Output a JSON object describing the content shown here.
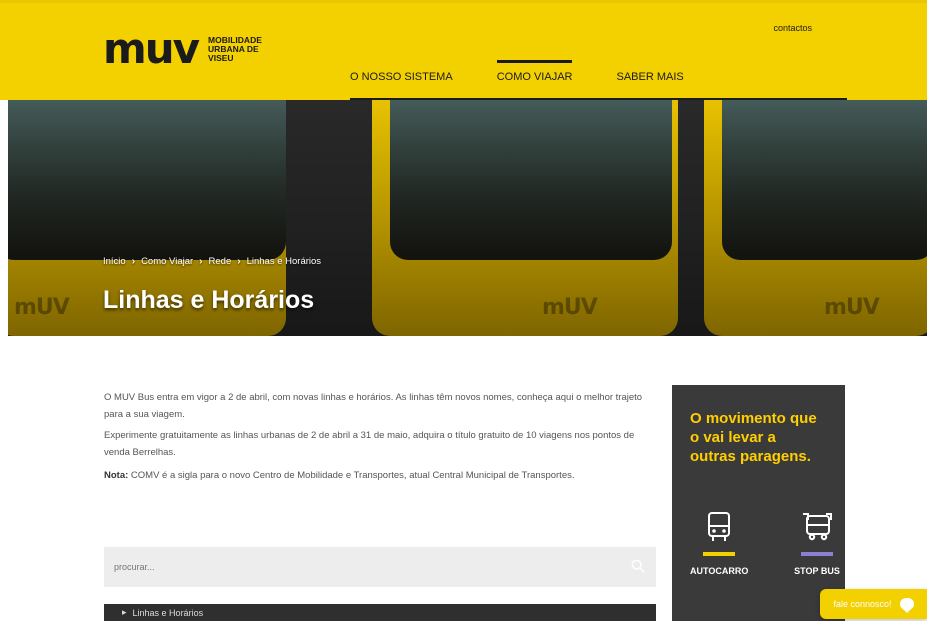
{
  "header": {
    "logo_text": "muv",
    "tagline": "MOBILIDADE URBANA DE VISEU",
    "contacts_label": "contactos",
    "nav": [
      {
        "label": "O NOSSO SISTEMA",
        "active": false
      },
      {
        "label": "COMO VIAJAR",
        "active": true
      },
      {
        "label": "SABER MAIS",
        "active": false
      }
    ]
  },
  "hero": {
    "breadcrumb": [
      "Início",
      "Como Viajar",
      "Rede",
      "Linhas e Horários"
    ],
    "title": "Linhas e Horários"
  },
  "content": {
    "paragraph1": "O MUV Bus entra em vigor a 2 de abril, com novas linhas e horários. As linhas têm novos nomes, conheça aqui o melhor trajeto para a sua viagem.",
    "paragraph2": "Experimente gratuitamente as linhas urbanas de 2 de abril a 31 de maio, adquira o título gratuito de 10 viagens nos pontos de venda Berrelhas.",
    "note_label": "Nota:",
    "note_text": " COMV é a sigla para o novo Centro de Mobilidade e Transportes, atual Central Municipal de Transportes."
  },
  "search": {
    "placeholder": "procurar..."
  },
  "list": {
    "header": "Linhas e Horários"
  },
  "promo": {
    "title": "O movimento que\no vai levar a\noutras paragens.",
    "items": [
      {
        "label": "AUTOCARRO",
        "icon": "bus-icon",
        "bar_color": "#f3d000"
      },
      {
        "label": "STOP BUS",
        "icon": "stop-bus-icon",
        "bar_color": "#8b7fd0"
      }
    ]
  },
  "chat": {
    "label": "fale connosco!"
  },
  "colors": {
    "brand_yellow": "#f3d000",
    "dark": "#1b1b1b",
    "promo_bg": "#3a3a3a"
  }
}
